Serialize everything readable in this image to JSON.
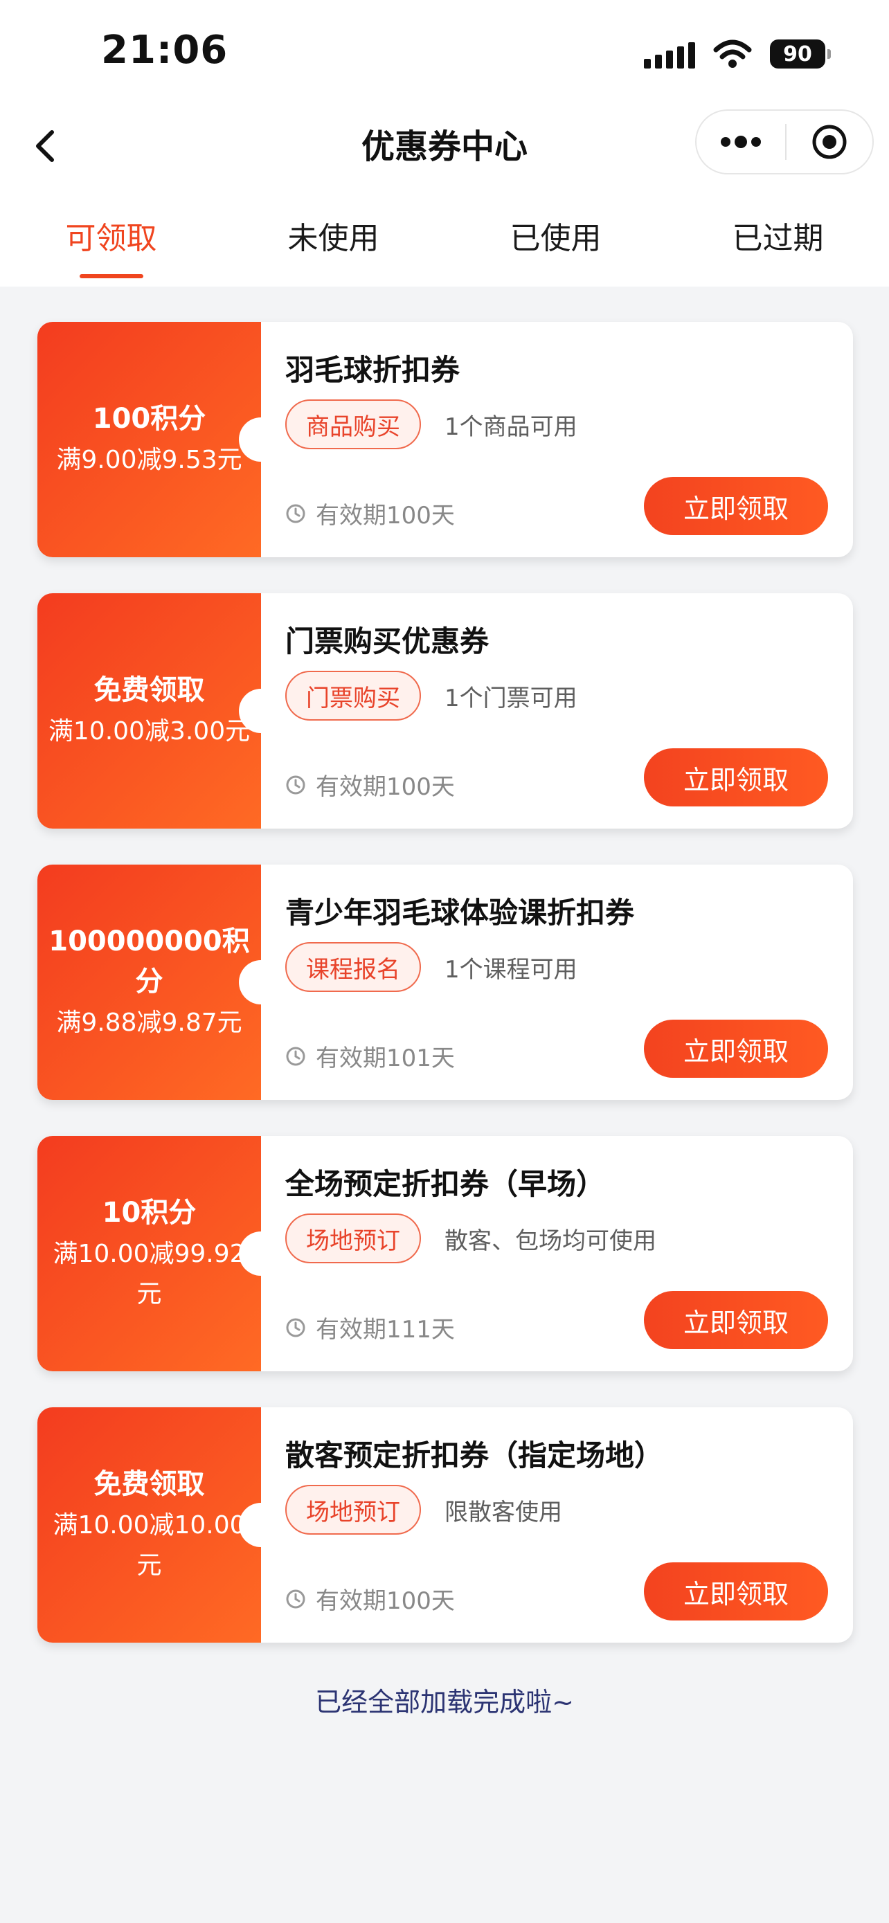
{
  "status_bar": {
    "time": "21:06",
    "battery": "90",
    "icons": [
      "signal-icon",
      "wifi-icon",
      "battery-icon"
    ]
  },
  "header": {
    "title": "优惠券中心",
    "icons": [
      "back-arrow-icon",
      "more-dots-icon",
      "target-icon"
    ]
  },
  "tabs": [
    {
      "label": "可领取",
      "active": true
    },
    {
      "label": "未使用",
      "active": false
    },
    {
      "label": "已使用",
      "active": false
    },
    {
      "label": "已过期",
      "active": false
    }
  ],
  "coupons": [
    {
      "value": "100积分",
      "condition": "满9.00减9.53元",
      "name": "羽毛球折扣券",
      "tag": "商品购买",
      "tag_desc": "1个商品可用",
      "validity": "有效期100天",
      "button": "立即领取"
    },
    {
      "value": "免费领取",
      "condition": "满10.00减3.00元",
      "name": "门票购买优惠券",
      "tag": "门票购买",
      "tag_desc": "1个门票可用",
      "validity": "有效期100天",
      "button": "立即领取"
    },
    {
      "value": "100000000积分",
      "condition": "满9.88减9.87元",
      "name": "青少年羽毛球体验课折扣券",
      "tag": "课程报名",
      "tag_desc": "1个课程可用",
      "validity": "有效期101天",
      "button": "立即领取"
    },
    {
      "value": "10积分",
      "condition": "满10.00减99.92元",
      "name": "全场预定折扣券（早场）",
      "tag": "场地预订",
      "tag_desc": "散客、包场均可使用",
      "validity": "有效期111天",
      "button": "立即领取"
    },
    {
      "value": "免费领取",
      "condition": "满10.00减10.00元",
      "name": "散客预定折扣券（指定场地）",
      "tag": "场地预订",
      "tag_desc": "限散客使用",
      "validity": "有效期100天",
      "button": "立即领取"
    }
  ],
  "footer": {
    "end_text": "已经全部加载完成啦~"
  },
  "colors": {
    "accent": "#f0451f",
    "coupon_gradient_start": "#f33c1f",
    "coupon_gradient_end": "#ff6a24",
    "end_text": "#2c3473",
    "background": "#f3f4f6"
  }
}
